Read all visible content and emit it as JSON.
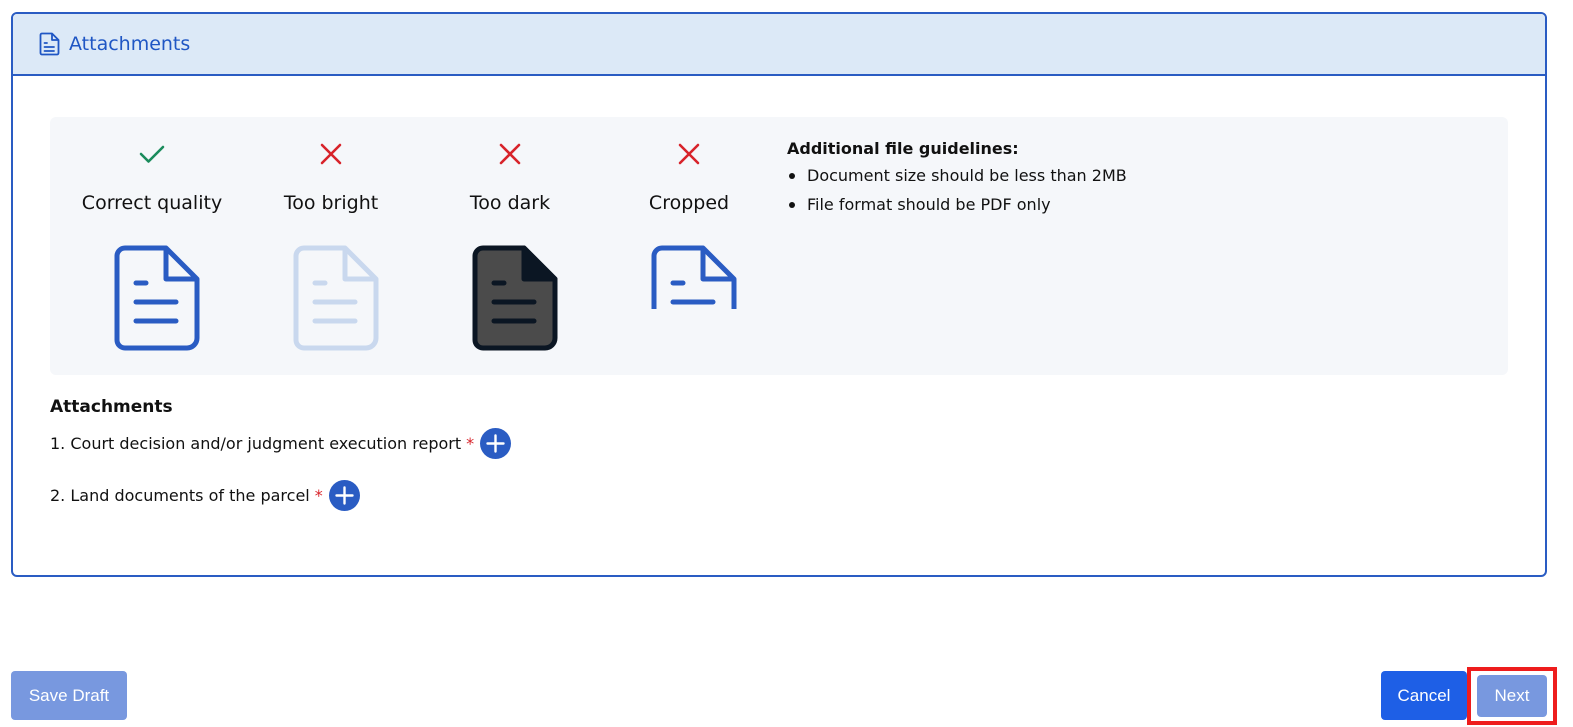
{
  "header": {
    "title": "Attachments",
    "icon": "document-icon"
  },
  "quality_examples": [
    {
      "label": "Correct quality",
      "status": "ok",
      "mark_icon": "check-icon",
      "mark_color": "#1a8b5c"
    },
    {
      "label": "Too bright",
      "status": "bad",
      "mark_icon": "x-icon",
      "mark_color": "#d8232a"
    },
    {
      "label": "Too dark",
      "status": "bad",
      "mark_icon": "x-icon",
      "mark_color": "#d8232a"
    },
    {
      "label": "Cropped",
      "status": "bad",
      "mark_icon": "x-icon",
      "mark_color": "#d8232a"
    }
  ],
  "guidelines": {
    "title": "Additional file guidelines:",
    "items": [
      "Document size should be less than 2MB",
      "File format should be PDF only"
    ]
  },
  "attachments": {
    "title": "Attachments",
    "items": [
      {
        "label": "1. Court decision and/or judgment execution report",
        "required_mark": "*"
      },
      {
        "label": "2. Land documents of the parcel",
        "required_mark": "*"
      }
    ]
  },
  "actions": {
    "save_draft": "Save Draft",
    "cancel": "Cancel",
    "next": "Next"
  },
  "colors": {
    "primary": "#2a5cc3",
    "header_bg": "#dce9f7",
    "button_light": "#7898df",
    "button_primary": "#1e5fe6",
    "required": "#d8232a",
    "highlight": "#ee1d1d"
  }
}
